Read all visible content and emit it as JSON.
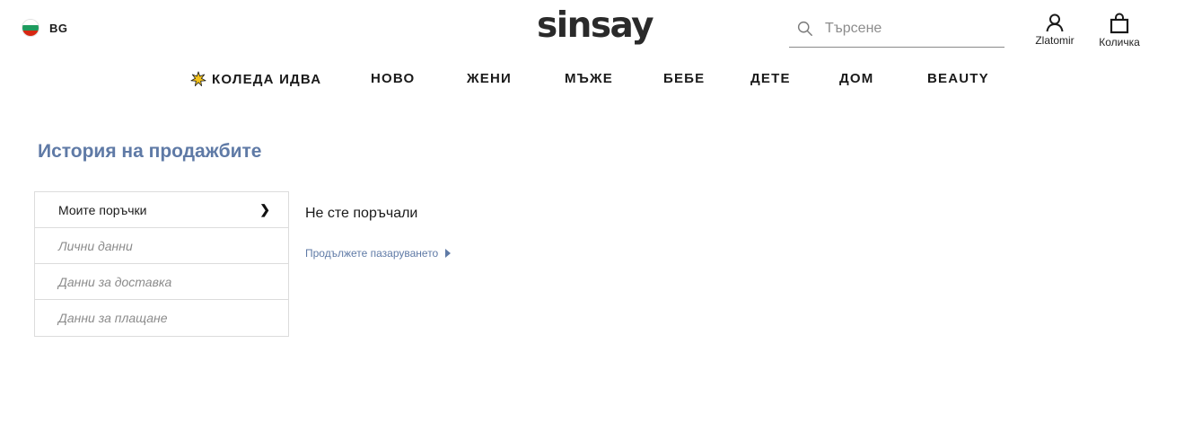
{
  "header": {
    "country_code": "BG",
    "logo": "sinsay",
    "search_placeholder": "Търсене",
    "account_label": "Zlatomir",
    "cart_label": "Количка"
  },
  "nav": {
    "items": [
      {
        "label": "КОЛЕДА ИДВА",
        "icon": "star-icon"
      },
      {
        "label": "НОВО"
      },
      {
        "label": "ЖЕНИ"
      },
      {
        "label": "МЪЖЕ"
      },
      {
        "label": "БЕБЕ"
      },
      {
        "label": "ДЕТЕ"
      },
      {
        "label": "ДОМ"
      },
      {
        "label": "BEAUTY"
      }
    ]
  },
  "page": {
    "title": "История на продажбите"
  },
  "side_menu": {
    "items": [
      {
        "label": "Моите поръчки",
        "active": true
      },
      {
        "label": "Лични данни"
      },
      {
        "label": "Данни за доставка"
      },
      {
        "label": "Данни за плащане"
      }
    ]
  },
  "content": {
    "empty_message": "Не сте поръчали",
    "continue_link": "Продължете пазаруването"
  },
  "colors": {
    "accent": "#5f7aa6",
    "text": "#1a1a1a",
    "muted": "#8b8b8b",
    "border": "#dcdcdc"
  }
}
